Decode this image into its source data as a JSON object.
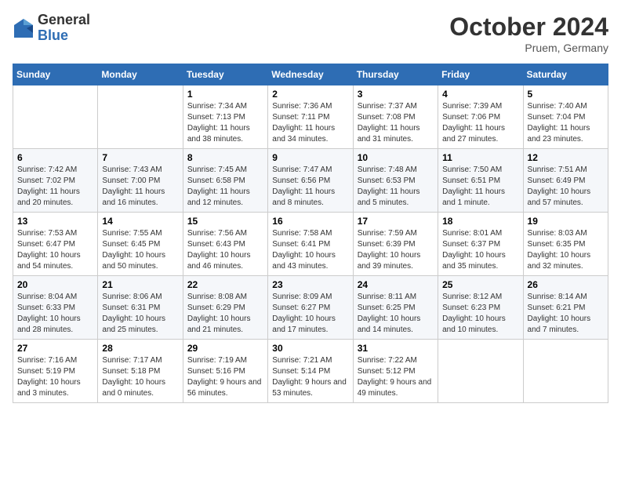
{
  "logo": {
    "general": "General",
    "blue": "Blue"
  },
  "title": "October 2024",
  "location": "Pruem, Germany",
  "days_header": [
    "Sunday",
    "Monday",
    "Tuesday",
    "Wednesday",
    "Thursday",
    "Friday",
    "Saturday"
  ],
  "weeks": [
    [
      {
        "day": "",
        "detail": ""
      },
      {
        "day": "",
        "detail": ""
      },
      {
        "day": "1",
        "detail": "Sunrise: 7:34 AM\nSunset: 7:13 PM\nDaylight: 11 hours and 38 minutes."
      },
      {
        "day": "2",
        "detail": "Sunrise: 7:36 AM\nSunset: 7:11 PM\nDaylight: 11 hours and 34 minutes."
      },
      {
        "day": "3",
        "detail": "Sunrise: 7:37 AM\nSunset: 7:08 PM\nDaylight: 11 hours and 31 minutes."
      },
      {
        "day": "4",
        "detail": "Sunrise: 7:39 AM\nSunset: 7:06 PM\nDaylight: 11 hours and 27 minutes."
      },
      {
        "day": "5",
        "detail": "Sunrise: 7:40 AM\nSunset: 7:04 PM\nDaylight: 11 hours and 23 minutes."
      }
    ],
    [
      {
        "day": "6",
        "detail": "Sunrise: 7:42 AM\nSunset: 7:02 PM\nDaylight: 11 hours and 20 minutes."
      },
      {
        "day": "7",
        "detail": "Sunrise: 7:43 AM\nSunset: 7:00 PM\nDaylight: 11 hours and 16 minutes."
      },
      {
        "day": "8",
        "detail": "Sunrise: 7:45 AM\nSunset: 6:58 PM\nDaylight: 11 hours and 12 minutes."
      },
      {
        "day": "9",
        "detail": "Sunrise: 7:47 AM\nSunset: 6:56 PM\nDaylight: 11 hours and 8 minutes."
      },
      {
        "day": "10",
        "detail": "Sunrise: 7:48 AM\nSunset: 6:53 PM\nDaylight: 11 hours and 5 minutes."
      },
      {
        "day": "11",
        "detail": "Sunrise: 7:50 AM\nSunset: 6:51 PM\nDaylight: 11 hours and 1 minute."
      },
      {
        "day": "12",
        "detail": "Sunrise: 7:51 AM\nSunset: 6:49 PM\nDaylight: 10 hours and 57 minutes."
      }
    ],
    [
      {
        "day": "13",
        "detail": "Sunrise: 7:53 AM\nSunset: 6:47 PM\nDaylight: 10 hours and 54 minutes."
      },
      {
        "day": "14",
        "detail": "Sunrise: 7:55 AM\nSunset: 6:45 PM\nDaylight: 10 hours and 50 minutes."
      },
      {
        "day": "15",
        "detail": "Sunrise: 7:56 AM\nSunset: 6:43 PM\nDaylight: 10 hours and 46 minutes."
      },
      {
        "day": "16",
        "detail": "Sunrise: 7:58 AM\nSunset: 6:41 PM\nDaylight: 10 hours and 43 minutes."
      },
      {
        "day": "17",
        "detail": "Sunrise: 7:59 AM\nSunset: 6:39 PM\nDaylight: 10 hours and 39 minutes."
      },
      {
        "day": "18",
        "detail": "Sunrise: 8:01 AM\nSunset: 6:37 PM\nDaylight: 10 hours and 35 minutes."
      },
      {
        "day": "19",
        "detail": "Sunrise: 8:03 AM\nSunset: 6:35 PM\nDaylight: 10 hours and 32 minutes."
      }
    ],
    [
      {
        "day": "20",
        "detail": "Sunrise: 8:04 AM\nSunset: 6:33 PM\nDaylight: 10 hours and 28 minutes."
      },
      {
        "day": "21",
        "detail": "Sunrise: 8:06 AM\nSunset: 6:31 PM\nDaylight: 10 hours and 25 minutes."
      },
      {
        "day": "22",
        "detail": "Sunrise: 8:08 AM\nSunset: 6:29 PM\nDaylight: 10 hours and 21 minutes."
      },
      {
        "day": "23",
        "detail": "Sunrise: 8:09 AM\nSunset: 6:27 PM\nDaylight: 10 hours and 17 minutes."
      },
      {
        "day": "24",
        "detail": "Sunrise: 8:11 AM\nSunset: 6:25 PM\nDaylight: 10 hours and 14 minutes."
      },
      {
        "day": "25",
        "detail": "Sunrise: 8:12 AM\nSunset: 6:23 PM\nDaylight: 10 hours and 10 minutes."
      },
      {
        "day": "26",
        "detail": "Sunrise: 8:14 AM\nSunset: 6:21 PM\nDaylight: 10 hours and 7 minutes."
      }
    ],
    [
      {
        "day": "27",
        "detail": "Sunrise: 7:16 AM\nSunset: 5:19 PM\nDaylight: 10 hours and 3 minutes."
      },
      {
        "day": "28",
        "detail": "Sunrise: 7:17 AM\nSunset: 5:18 PM\nDaylight: 10 hours and 0 minutes."
      },
      {
        "day": "29",
        "detail": "Sunrise: 7:19 AM\nSunset: 5:16 PM\nDaylight: 9 hours and 56 minutes."
      },
      {
        "day": "30",
        "detail": "Sunrise: 7:21 AM\nSunset: 5:14 PM\nDaylight: 9 hours and 53 minutes."
      },
      {
        "day": "31",
        "detail": "Sunrise: 7:22 AM\nSunset: 5:12 PM\nDaylight: 9 hours and 49 minutes."
      },
      {
        "day": "",
        "detail": ""
      },
      {
        "day": "",
        "detail": ""
      }
    ]
  ]
}
